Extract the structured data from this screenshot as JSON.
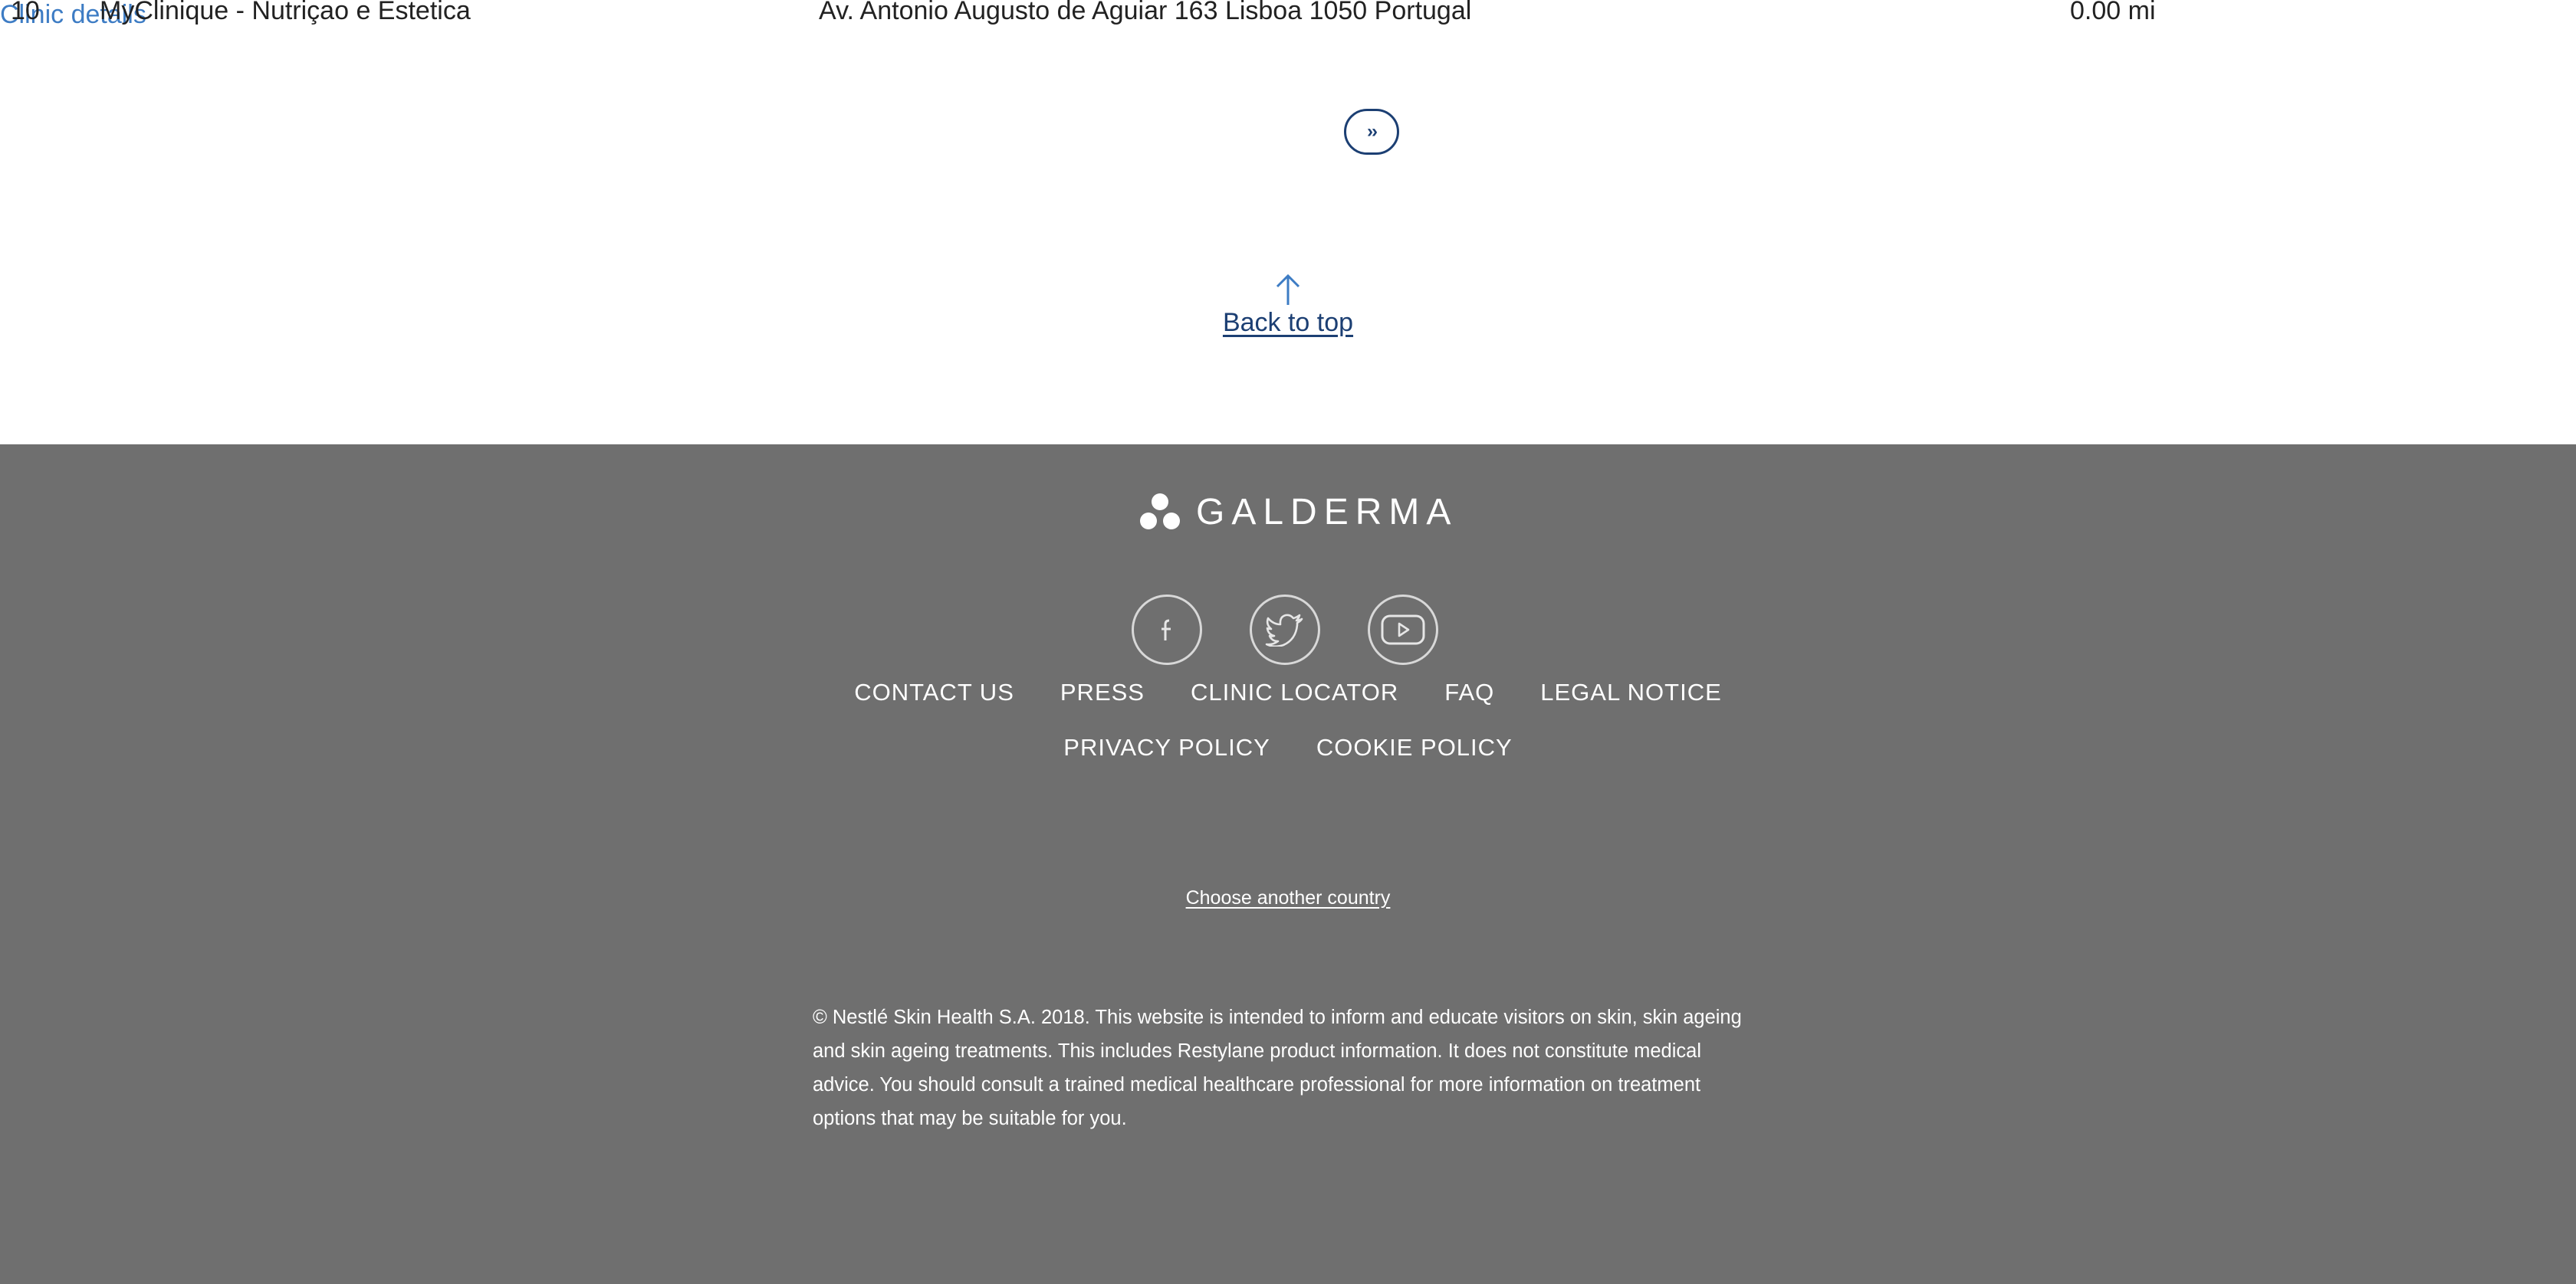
{
  "results": {
    "row": {
      "number": "10",
      "name": "MyClinique - Nutriçao e Estetica",
      "address": "Av. Antonio Augusto de Aguiar 163 Lisboa 1050 Portugal",
      "distance": "0.00 mi",
      "details_link": "Clinic details"
    },
    "pagination": {
      "next_label": "››"
    }
  },
  "back_to_top": {
    "label": "Back to top",
    "icon": "arrow-up-icon"
  },
  "footer": {
    "brand": "GALDERMA",
    "social": [
      {
        "icon": "facebook-icon"
      },
      {
        "icon": "twitter-icon"
      },
      {
        "icon": "youtube-icon"
      }
    ],
    "nav_row_1": [
      "CONTACT US",
      "PRESS",
      "CLINIC LOCATOR",
      "FAQ",
      "LEGAL NOTICE"
    ],
    "nav_row_2": [
      "PRIVACY POLICY",
      "COOKIE POLICY"
    ],
    "choose_country": "Choose another country",
    "disclaimer": "© Nestlé Skin Health S.A. 2018. This website is intended to inform and educate visitors on skin, skin ageing and skin ageing treatments. This includes Restylane product information. It does not constitute medical advice. You should consult a trained medical healthcare professional for more information on treatment options that may be suitable for you."
  },
  "colors": {
    "link_blue": "#3d7cc4",
    "navy": "#1c3f73",
    "footer_bg": "#6f6f6f"
  }
}
